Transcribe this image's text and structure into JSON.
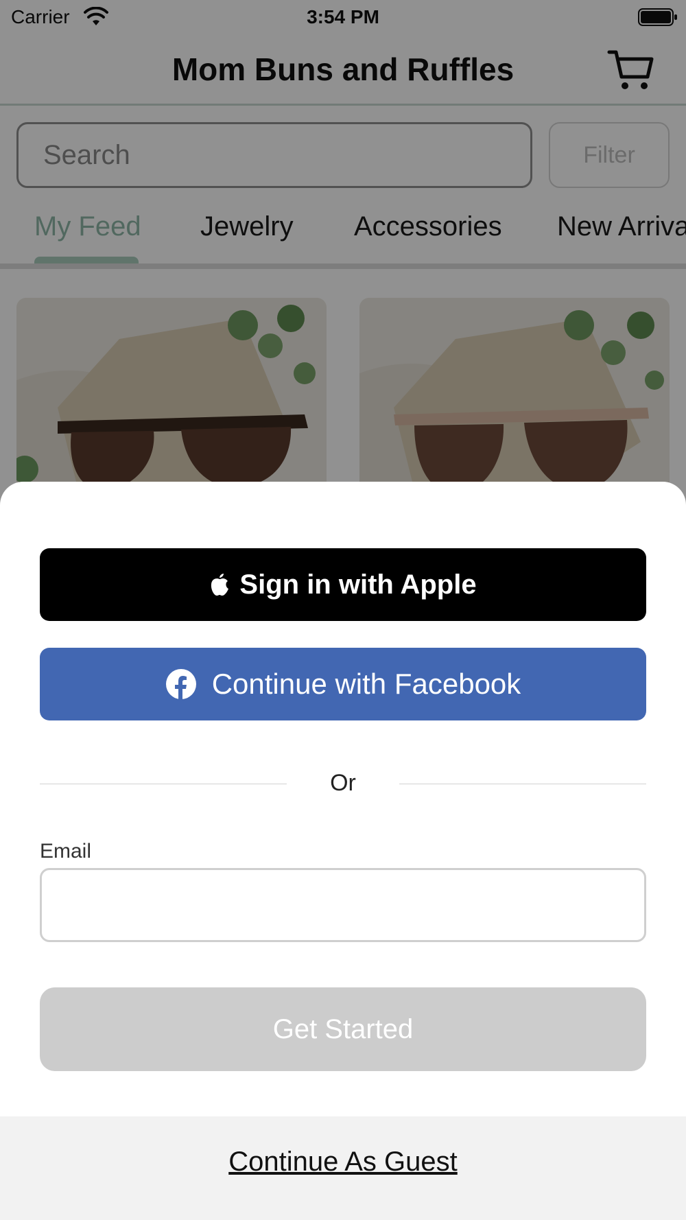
{
  "status_bar": {
    "carrier": "Carrier",
    "time": "3:54 PM"
  },
  "nav": {
    "title": "Mom Buns and Ruffles",
    "cart_icon": "cart-icon"
  },
  "search": {
    "placeholder": "Search",
    "filter_label": "Filter"
  },
  "tabs": [
    {
      "label": "My Feed",
      "active": true
    },
    {
      "label": "Jewelry",
      "active": false
    },
    {
      "label": "Accessories",
      "active": false
    },
    {
      "label": "New Arrivals",
      "active": false
    }
  ],
  "sheet": {
    "apple_label": "Sign in with Apple",
    "facebook_label": "Continue with Facebook",
    "divider_text": "Or",
    "email_label": "Email",
    "email_value": "",
    "get_started_label": "Get Started",
    "guest_label": "Continue As Guest"
  },
  "colors": {
    "accent": "#a9cdbd",
    "facebook": "#4267b2",
    "apple": "#000000",
    "disabled_button": "#cccccc"
  }
}
